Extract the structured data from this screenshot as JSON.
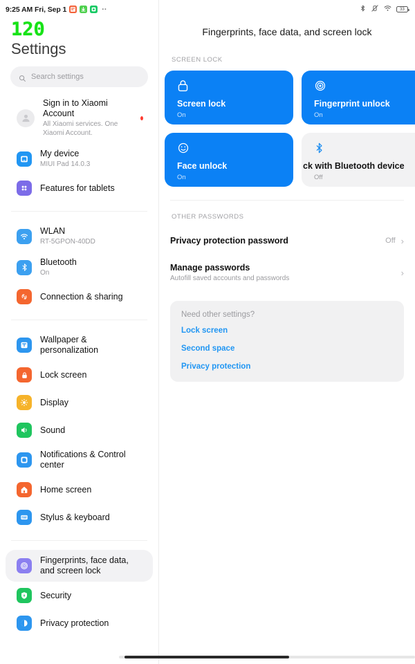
{
  "status_bar": {
    "time_date": "9:25 AM Fri, Sep 1",
    "overflow_dots": "··",
    "left_icons": [
      "calendar-app-icon",
      "download-app-icon",
      "security-app-icon"
    ],
    "right_icons": [
      "bluetooth-icon",
      "vibrate-mute-icon",
      "wifi-icon",
      "battery-icon"
    ],
    "battery_level": "33"
  },
  "sidebar": {
    "fps_overlay": "120",
    "title": "Settings",
    "search": {
      "placeholder": "Search settings",
      "icon": "search-icon"
    },
    "groups": [
      {
        "items": [
          {
            "icon": "account-avatar-icon",
            "label": "Sign in to Xiaomi Account",
            "sub": "All Xiaomi services. One Xiaomi Account.",
            "badge": true
          },
          {
            "icon": "my-device-icon",
            "label": "My device",
            "sub": "MIUI Pad 14.0.3"
          },
          {
            "icon": "features-tablets-icon",
            "label": "Features for tablets",
            "sub": ""
          }
        ]
      },
      {
        "items": [
          {
            "icon": "wlan-icon",
            "label": "WLAN",
            "sub": "RT-5GPON-40DD"
          },
          {
            "icon": "bluetooth-icon",
            "label": "Bluetooth",
            "sub": "On"
          },
          {
            "icon": "connection-sharing-icon",
            "label": "Connection & sharing",
            "sub": ""
          }
        ]
      },
      {
        "items": [
          {
            "icon": "wallpaper-icon",
            "label": "Wallpaper & personalization",
            "sub": ""
          },
          {
            "icon": "lock-screen-icon",
            "label": "Lock screen",
            "sub": ""
          },
          {
            "icon": "display-icon",
            "label": "Display",
            "sub": ""
          },
          {
            "icon": "sound-icon",
            "label": "Sound",
            "sub": ""
          },
          {
            "icon": "notifications-icon",
            "label": "Notifications & Control center",
            "sub": ""
          },
          {
            "icon": "home-screen-icon",
            "label": "Home screen",
            "sub": ""
          },
          {
            "icon": "stylus-keyboard-icon",
            "label": "Stylus & keyboard",
            "sub": ""
          }
        ]
      },
      {
        "items": [
          {
            "icon": "fingerprint-icon",
            "label": "Fingerprints, face data, and screen lock",
            "sub": "",
            "selected": true
          },
          {
            "icon": "security-icon",
            "label": "Security",
            "sub": ""
          },
          {
            "icon": "privacy-protection-icon",
            "label": "Privacy protection",
            "sub": ""
          }
        ]
      }
    ]
  },
  "main": {
    "page_title": "Fingerprints, face data, and screen lock",
    "screen_lock_label": "SCREEN LOCK",
    "cards": [
      {
        "icon": "padlock-icon",
        "title": "Screen lock",
        "status": "On",
        "style": "blue"
      },
      {
        "icon": "fingerprint-ring-icon",
        "title": "Fingerprint unlock",
        "status": "On",
        "style": "blue"
      },
      {
        "icon": "smiley-face-icon",
        "title": "Face unlock",
        "status": "On",
        "style": "blue"
      },
      {
        "icon": "bluetooth-icon",
        "title": "ck with Bluetooth device",
        "status": "Off",
        "style": "grey"
      }
    ],
    "other_passwords_label": "OTHER PASSWORDS",
    "rows": [
      {
        "title": "Privacy protection password",
        "sub": "",
        "value": "Off",
        "chevron": "›"
      },
      {
        "title": "Manage passwords",
        "sub": "Autofill saved accounts and passwords",
        "value": "",
        "chevron": "›"
      }
    ],
    "help": {
      "question": "Need other settings?",
      "links": [
        "Lock screen",
        "Second space",
        "Privacy protection"
      ]
    }
  },
  "colors": {
    "accent_blue": "#0b81f5",
    "link_blue": "#2196f3",
    "fps_green": "#16e216",
    "badge_red": "#ff3b30"
  }
}
